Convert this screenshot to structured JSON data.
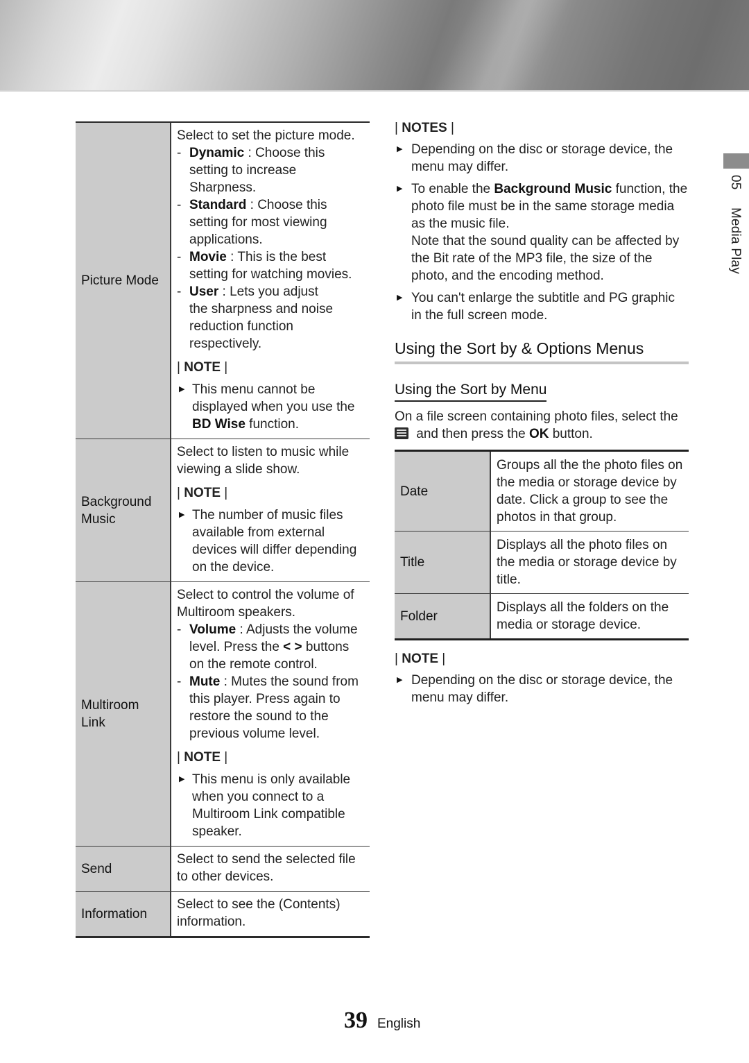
{
  "side_tab": {
    "chapter_number": "05",
    "chapter_title": "Media Play"
  },
  "left_table": {
    "rows": [
      {
        "label": "Picture Mode",
        "description": "Select to set the picture mode.",
        "options": [
          {
            "name": "Dynamic",
            "text": " : Choose this setting to increase Sharpness."
          },
          {
            "name": "Standard",
            "text": " : Choose this setting for most viewing applications."
          },
          {
            "name": "Movie",
            "text": " : This is the best setting for watching movies."
          },
          {
            "name": "User",
            "text": " : Lets you adjust the sharpness and noise reduction function respectively."
          }
        ],
        "note_heading": "NOTE",
        "notes": [
          {
            "before": "This menu cannot be displayed when you use the ",
            "bold": "BD Wise",
            "after": " function."
          }
        ]
      },
      {
        "label": "Background Music",
        "description": "Select to listen to music while viewing a slide show.",
        "note_heading": "NOTE",
        "notes": [
          {
            "text": "The number of music files available from external devices will differ depending on the device."
          }
        ]
      },
      {
        "label": "Multiroom Link",
        "description": "Select to control the volume of Multiroom speakers.",
        "options": [
          {
            "name": "Volume",
            "text_before": " : Adjusts the volume level. Press the ",
            "glyphs": "< >",
            "text_after": " buttons on the remote control."
          },
          {
            "name": "Mute",
            "text": " : Mutes the sound from this player. Press again to restore the sound to the previous volume level."
          }
        ],
        "note_heading": "NOTE",
        "notes": [
          {
            "text": "This menu is only available when you connect to a Multiroom Link compatible speaker."
          }
        ]
      },
      {
        "label": "Send",
        "description": "Select to send the selected file to other devices."
      },
      {
        "label": "Information",
        "description": "Select to see the (Contents) information."
      }
    ]
  },
  "right_column": {
    "notes_heading": "NOTES",
    "notes": [
      {
        "text": "Depending on the disc or storage device, the menu may differ."
      },
      {
        "before": "To enable the ",
        "bold": "Background Music",
        "after": " function, the photo file must be in the same storage media as the music file.",
        "extra": "Note that the sound quality can be affected by the Bit rate of the MP3 file, the size of the photo, and the encoding method."
      },
      {
        "text": "You can't enlarge the subtitle and PG graphic in the full screen mode."
      }
    ],
    "section_title": "Using the Sort by & Options Menus",
    "subsection_title": "Using the Sort by Menu",
    "intro": {
      "before_icon": "On a file screen containing photo files, select the",
      "icon": "menu-list-icon",
      "after_icon": " and then press the ",
      "bold": "OK",
      "end": " button."
    },
    "sort_table": [
      {
        "label": "Date",
        "description": "Groups all the the photo files on the media or storage device by date. Click a group to see the photos in that group."
      },
      {
        "label": "Title",
        "description": "Displays all the photo files on the media or storage device by title."
      },
      {
        "label": "Folder",
        "description": "Displays all the folders on the media or storage device."
      }
    ],
    "note_heading": "NOTE",
    "note": {
      "text": "Depending on the disc or storage device, the menu may differ."
    }
  },
  "footer": {
    "page_number": "39",
    "language": "English"
  }
}
